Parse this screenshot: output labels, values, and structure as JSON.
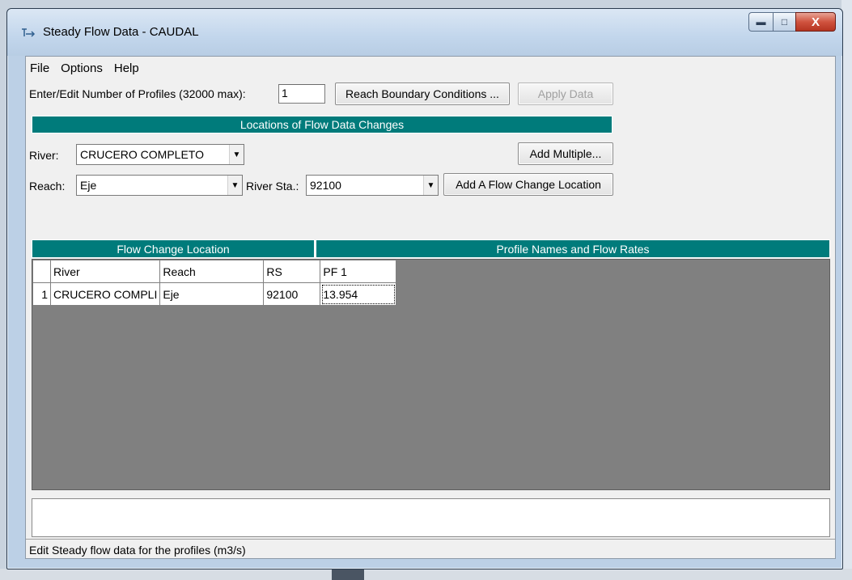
{
  "window": {
    "title": "Steady Flow Data - CAUDAL"
  },
  "menu": [
    "File",
    "Options",
    "Help"
  ],
  "profiles": {
    "label": "Enter/Edit Number of Profiles (32000 max):",
    "value": "1",
    "reach_bc_button": "Reach Boundary Conditions ...",
    "apply_button": "Apply Data"
  },
  "locations": {
    "header": "Locations of Flow Data Changes",
    "river_label": "River:",
    "river_value": "CRUCERO COMPLETO",
    "add_multiple_button": "Add Multiple...",
    "reach_label": "Reach:",
    "reach_value": "Eje",
    "river_sta_label": "River Sta.:",
    "river_sta_value": "92100",
    "add_location_button": "Add A Flow Change Location"
  },
  "table": {
    "left_header": "Flow Change Location",
    "right_header": "Profile Names and Flow Rates",
    "columns": [
      "River",
      "Reach",
      "RS",
      "PF 1"
    ],
    "rows": [
      {
        "num": "1",
        "river": "CRUCERO COMPLI",
        "reach": "Eje",
        "rs": "92100",
        "pf1": "13.954"
      }
    ]
  },
  "status": "Edit Steady flow data for the profiles (m3/s)"
}
